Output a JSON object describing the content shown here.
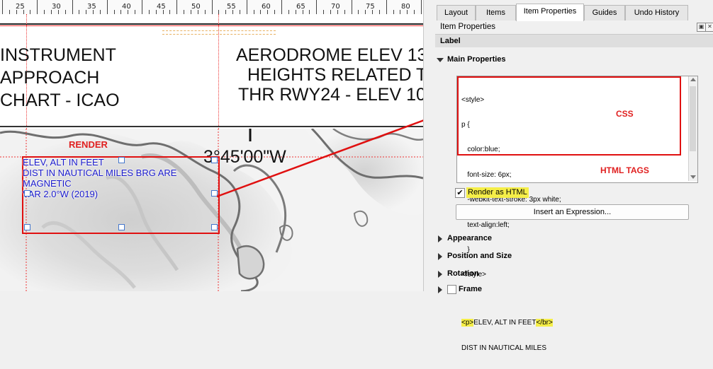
{
  "ruler": {
    "labels": [
      "25",
      "30",
      "35",
      "40",
      "45",
      "50",
      "55",
      "60",
      "65",
      "70",
      "75",
      "80"
    ]
  },
  "chart": {
    "title_left_1": "INSTRUMENT",
    "title_left_2": "APPROACH",
    "title_left_3": "CHART - ICAO",
    "title_right_1": "AERODROME ELEV 13",
    "title_right_2": "HEIGHTS RELATED TO",
    "title_right_3": "THR RWY24 - ELEV 10",
    "coordinate": "3°45'00\"W",
    "render_annotation": "RENDER",
    "label_line1": "ELEV, ALT IN FEET",
    "label_line2": "DIST IN NAUTICAL MILES BRG ARE",
    "label_line3": "MAGNETIC",
    "label_line4": "VAR 2.0°W (2019)"
  },
  "tabs": {
    "layout": "Layout",
    "items": "Items",
    "item_properties": "Item Properties",
    "guides": "Guides",
    "undo_history": "Undo History"
  },
  "panel": {
    "title": "Item Properties",
    "section_header": "Label",
    "main_properties": "Main Properties",
    "css_annotation": "CSS",
    "html_annotation": "HTML TAGS",
    "render_as_html": "Render as HTML",
    "insert_expression": "Insert an Expression...",
    "appearance": "Appearance",
    "position_and_size": "Position and Size",
    "rotation": "Rotation",
    "frame": "Frame"
  },
  "editor": {
    "line1": "<style>",
    "line2": "p {",
    "line3": "   color:blue;",
    "line4": "   font-size: 6px;",
    "line5": "   -webkit-text-stroke: 3px white;",
    "line6": "   text-align:left;",
    "line7": "   }",
    "line8": "</style>",
    "line10_open": "<p>",
    "line10_text": "ELEV, ALT IN FEET",
    "line10_close": "</br>",
    "line11": "DIST IN NAUTICAL MILES"
  },
  "colors": {
    "annotation_red": "#e01010",
    "label_blue": "#1a1acc",
    "highlight_yellow": "#f5ee48"
  }
}
